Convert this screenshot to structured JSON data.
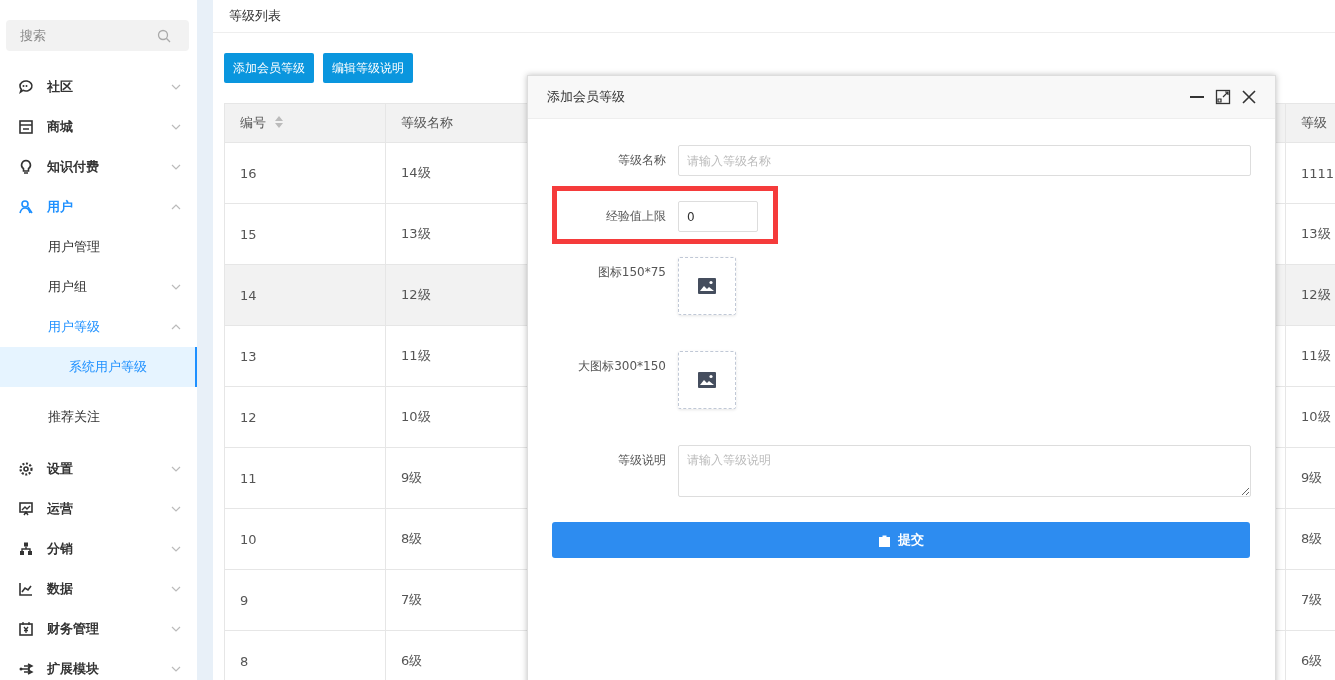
{
  "sidebar": {
    "search": {
      "placeholder": "搜索"
    },
    "items": [
      {
        "label": "社区",
        "kind": "group",
        "expanded": false,
        "selected": false
      },
      {
        "label": "商城",
        "kind": "group",
        "expanded": false,
        "selected": false
      },
      {
        "label": "知识付费",
        "kind": "group",
        "expanded": false,
        "selected": false
      },
      {
        "label": "用户",
        "kind": "group",
        "expanded": true,
        "selected": false,
        "children": [
          {
            "label": "用户管理",
            "kind": "leaf",
            "selected": false
          },
          {
            "label": "用户组",
            "kind": "group",
            "expanded": false,
            "selected": false
          },
          {
            "label": "用户等级",
            "kind": "group",
            "expanded": true,
            "selected": false,
            "children": [
              {
                "label": "系统用户等级",
                "kind": "leaf",
                "selected": true
              }
            ]
          },
          {
            "label": "推荐关注",
            "kind": "leaf",
            "selected": false
          }
        ]
      },
      {
        "label": "设置",
        "kind": "group",
        "expanded": false,
        "selected": false
      },
      {
        "label": "运营",
        "kind": "group",
        "expanded": false,
        "selected": false
      },
      {
        "label": "分销",
        "kind": "group",
        "expanded": false,
        "selected": false
      },
      {
        "label": "数据",
        "kind": "group",
        "expanded": false,
        "selected": false
      },
      {
        "label": "财务管理",
        "kind": "group",
        "expanded": false,
        "selected": false
      },
      {
        "label": "扩展模块",
        "kind": "group",
        "expanded": false,
        "selected": false
      }
    ]
  },
  "page_title": "等级列表",
  "toolbar": [
    "添加会员等级",
    "编辑等级说明"
  ],
  "table": {
    "columns": [
      "编号",
      "等级名称",
      "等级"
    ],
    "rows": [
      {
        "cells": [
          "16",
          "14级",
          "1111"
        ],
        "selected": false
      },
      {
        "cells": [
          "15",
          "13级",
          "13级"
        ],
        "selected": false
      },
      {
        "cells": [
          "14",
          "12级",
          "12级"
        ],
        "selected": true
      },
      {
        "cells": [
          "13",
          "11级",
          "11级"
        ],
        "selected": false
      },
      {
        "cells": [
          "12",
          "10级",
          "10级"
        ],
        "selected": false
      },
      {
        "cells": [
          "11",
          "9级",
          "9级"
        ],
        "selected": false
      },
      {
        "cells": [
          "10",
          "8级",
          "8级"
        ],
        "selected": false
      },
      {
        "cells": [
          "9",
          "7级",
          "7级"
        ],
        "selected": false
      },
      {
        "cells": [
          "8",
          "6级",
          "6级"
        ],
        "selected": false
      }
    ]
  },
  "dialog": {
    "title": "添加会员等级",
    "fields": [
      {
        "label": "等级名称",
        "kind": "text",
        "placeholder": "请输入等级名称",
        "highlighted": false
      },
      {
        "label": "经验值上限",
        "kind": "short",
        "value": "0",
        "highlighted": true
      },
      {
        "label": "图标150*75",
        "kind": "image",
        "highlighted": false
      },
      {
        "label": "大图标300*150",
        "kind": "image",
        "highlighted": false
      },
      {
        "label": "等级说明",
        "kind": "textarea",
        "placeholder": "请输入等级说明",
        "highlighted": false
      }
    ],
    "submit": "提交"
  }
}
